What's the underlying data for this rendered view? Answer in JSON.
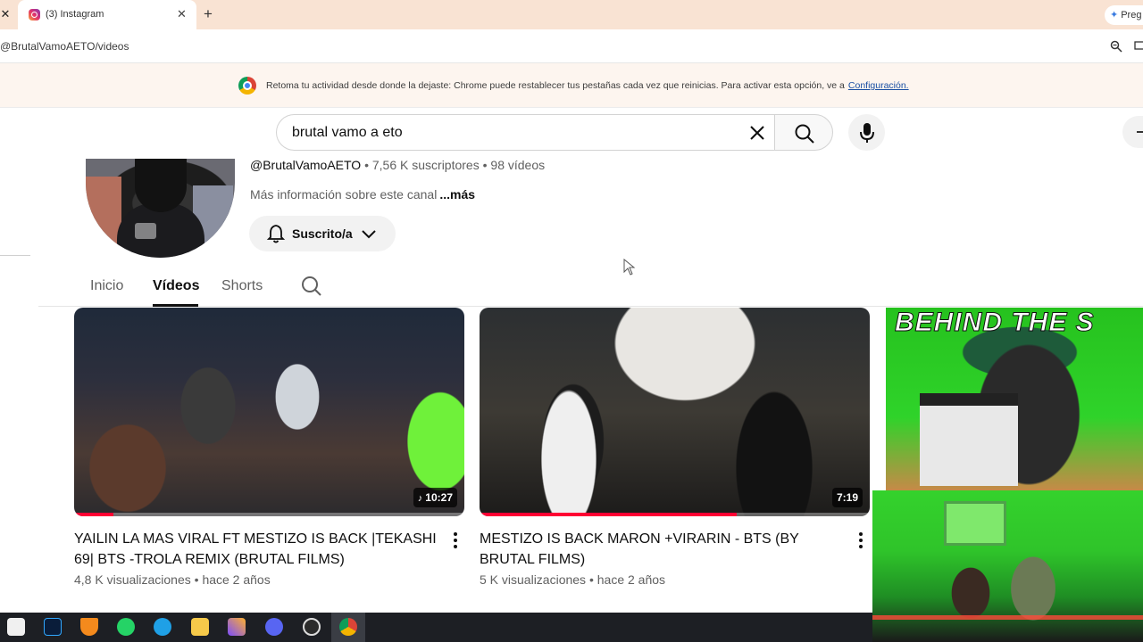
{
  "browser": {
    "tab_title": "(3) Instagram",
    "new_tab_symbol": "+",
    "close_symbol": "✕",
    "gemini_label": "Preg",
    "url": "@BrutalVamoAETO/videos",
    "restore_message": "Retoma tu actividad desde donde la dejaste: Chrome puede restablecer tus pestañas cada vez que reinicias. Para activar esta opción, ve a",
    "restore_link": "Configuración."
  },
  "search": {
    "query": "brutal vamo a eto"
  },
  "channel": {
    "handle": "@BrutalVamoAETO",
    "subscribers": "7,56 K suscriptores",
    "videos_count": "98 vídeos",
    "separator": "•",
    "about": "Más información sobre este canal",
    "more": "...más",
    "subscribe_label": "Suscrito/a"
  },
  "tabs": [
    {
      "label": "Inicio"
    },
    {
      "label": "Vídeos"
    },
    {
      "label": "Shorts"
    }
  ],
  "videos": [
    {
      "title": "YAILIN LA MAS VIRAL FT MESTIZO IS BACK |TEKASHI 69| BTS -TROLA REMIX  (BRUTAL FILMS)",
      "views": "4,8 K visualizaciones",
      "age": "hace 2 años",
      "duration": "10:27",
      "duration_icon": "♪",
      "watched_fraction": 0.1
    },
    {
      "title": "MESTIZO IS BACK MARON +VIRARIN - BTS   (BY BRUTAL FILMS)",
      "views": "5 K visualizaciones",
      "age": "hace 2 años",
      "duration": "7:19",
      "watched_fraction": 0.66
    },
    {
      "thumbnail_text": "BEHIND THE S"
    }
  ],
  "icons": {
    "search": "search-icon",
    "clear": "clear-icon",
    "mic": "microphone-icon",
    "bell": "bell-icon",
    "chevron": "chevron-down-icon",
    "more": "more-vert-icon"
  },
  "colors": {
    "accent_red": "#ff0033",
    "tabbar": "#f9e3d3",
    "link": "#1a4fa3"
  }
}
